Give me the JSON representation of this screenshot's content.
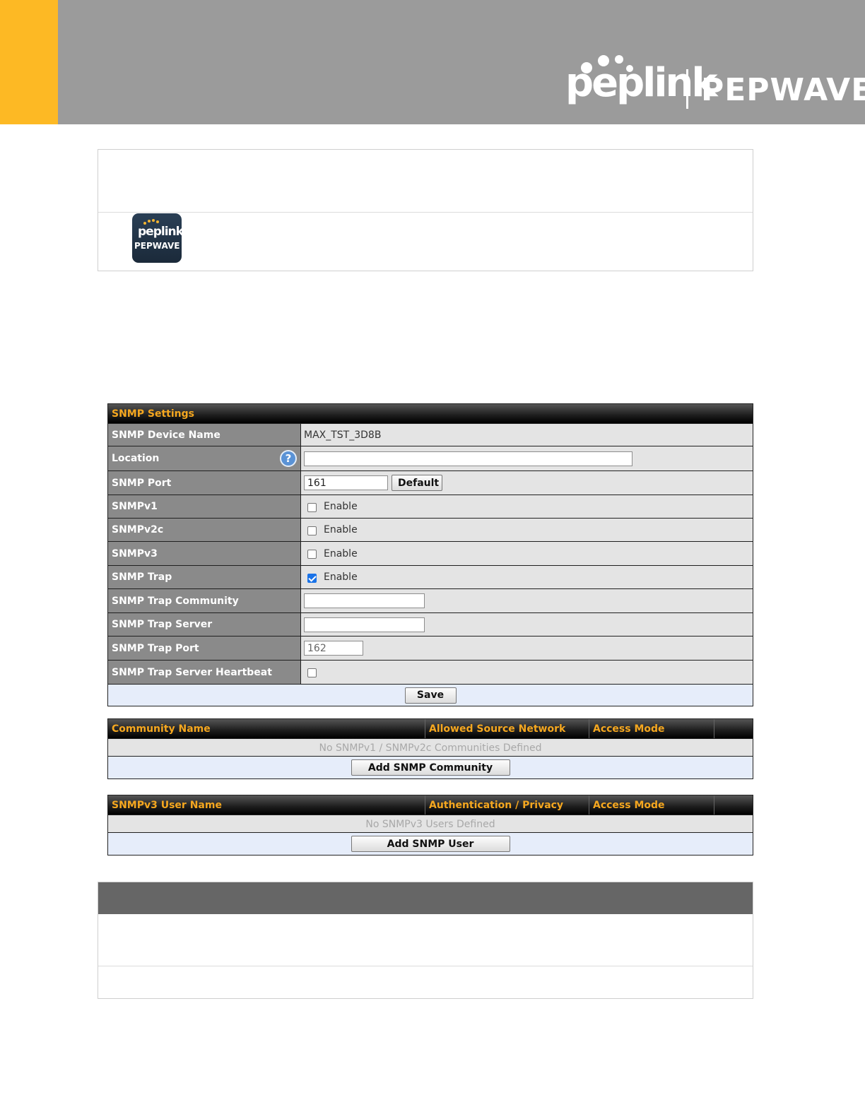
{
  "header": {
    "brand_peplink": "peplink",
    "brand_pepwave": "PEPWAVE"
  },
  "note_icon": {
    "line1": "peplink",
    "line2": "PEPWAVE"
  },
  "snmp_settings": {
    "title": "SNMP Settings",
    "device_name_label": "SNMP Device Name",
    "device_name_value": "MAX_TST_3D8B",
    "location_label": "Location",
    "location_value": "",
    "port_label": "SNMP Port",
    "port_value": "161",
    "default_button": "Default",
    "v1_label": "SNMPv1",
    "v1_enable": "Enable",
    "v2c_label": "SNMPv2c",
    "v2c_enable": "Enable",
    "v3_label": "SNMPv3",
    "v3_enable": "Enable",
    "trap_label": "SNMP Trap",
    "trap_enable": "Enable",
    "trap_community_label": "SNMP Trap Community",
    "trap_community_value": "",
    "trap_server_label": "SNMP Trap Server",
    "trap_server_value": "",
    "trap_port_label": "SNMP Trap Port",
    "trap_port_value": "162",
    "trap_heartbeat_label": "SNMP Trap Server Heartbeat",
    "save_button": "Save",
    "help_glyph": "?"
  },
  "communities": {
    "col_name": "Community Name",
    "col_network": "Allowed Source Network",
    "col_access": "Access Mode",
    "empty_text": "No SNMPv1 / SNMPv2c Communities Defined",
    "add_button": "Add SNMP Community"
  },
  "users": {
    "col_name": "SNMPv3 User Name",
    "col_auth": "Authentication / Privacy",
    "col_access": "Access Mode",
    "empty_text": "No SNMPv3 Users Defined",
    "add_button": "Add SNMP User"
  },
  "colors": {
    "accent": "#fdb924",
    "header_band": "#9b9b9b",
    "table_heading_text": "#f5a71f",
    "label_cell": "#8a8a8a"
  }
}
